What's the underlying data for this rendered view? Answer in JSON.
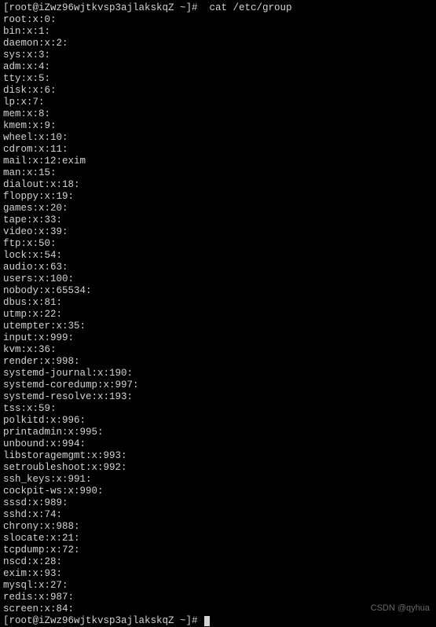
{
  "prompt_start": "[root@iZwz96wjtkvsp3ajlakskqZ ~]#  cat /etc/group",
  "lines": [
    "root:x:0:",
    "bin:x:1:",
    "daemon:x:2:",
    "sys:x:3:",
    "adm:x:4:",
    "tty:x:5:",
    "disk:x:6:",
    "lp:x:7:",
    "mem:x:8:",
    "kmem:x:9:",
    "wheel:x:10:",
    "cdrom:x:11:",
    "mail:x:12:exim",
    "man:x:15:",
    "dialout:x:18:",
    "floppy:x:19:",
    "games:x:20:",
    "tape:x:33:",
    "video:x:39:",
    "ftp:x:50:",
    "lock:x:54:",
    "audio:x:63:",
    "users:x:100:",
    "nobody:x:65534:",
    "dbus:x:81:",
    "utmp:x:22:",
    "utempter:x:35:",
    "input:x:999:",
    "kvm:x:36:",
    "render:x:998:",
    "systemd-journal:x:190:",
    "systemd-coredump:x:997:",
    "systemd-resolve:x:193:",
    "tss:x:59:",
    "polkitd:x:996:",
    "printadmin:x:995:",
    "unbound:x:994:",
    "libstoragemgmt:x:993:",
    "setroubleshoot:x:992:",
    "ssh_keys:x:991:",
    "cockpit-ws:x:990:",
    "sssd:x:989:",
    "sshd:x:74:",
    "chrony:x:988:",
    "slocate:x:21:",
    "tcpdump:x:72:",
    "nscd:x:28:",
    "exim:x:93:",
    "mysql:x:27:",
    "redis:x:987:",
    "screen:x:84:"
  ],
  "prompt_end": "[root@iZwz96wjtkvsp3ajlakskqZ ~]# ",
  "watermark": "CSDN @qyhua"
}
